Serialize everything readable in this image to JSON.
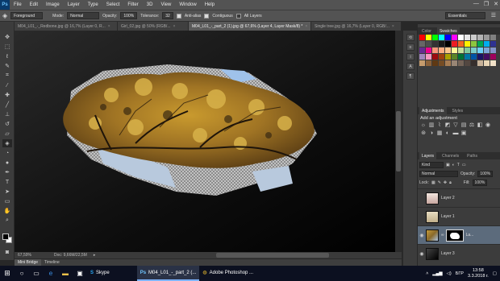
{
  "menubar": {
    "logo": "Ps",
    "items": [
      "File",
      "Edit",
      "Image",
      "Layer",
      "Type",
      "Select",
      "Filter",
      "3D",
      "View",
      "Window",
      "Help"
    ],
    "window_controls": [
      "—",
      "❐",
      "✕"
    ]
  },
  "options": {
    "source": "Foreground",
    "mode_label": "Mode:",
    "mode_value": "Normal",
    "opacity_label": "Opacity:",
    "opacity_value": "100%",
    "tolerance_label": "Tolerance:",
    "tolerance_value": "32",
    "antialias_label": "Anti-alias",
    "contiguous_label": "Contiguous",
    "all_layers_label": "All Layers",
    "workspace": "Essentials"
  },
  "tabs": [
    {
      "label": "M04_L01_-_Redbone.jpg @ 16,7% (Layer 0, R...",
      "active": false
    },
    {
      "label": "Girl_02.jpg @ 50% (RGB/...",
      "active": false
    },
    {
      "label": "M04_L01_-_part_2 (1).jpg @ 67,6% (Layer 4, Layer Mask/8) *",
      "active": true
    },
    {
      "label": "Single tree.jpg @ 16,7% (Layer 0, RGB/...",
      "active": false
    }
  ],
  "status": {
    "zoom": "67,59%",
    "doc": "Doc: 9,66M/22,5M"
  },
  "bridge": {
    "tabs": [
      "Mini Bridge",
      "Timeline"
    ]
  },
  "panels": {
    "color_tabs": [
      "Color",
      "Swatches"
    ],
    "adjust_tabs": [
      "Adjustments",
      "Styles"
    ],
    "adjust_title": "Add an adjustment",
    "layers_tabs": [
      "Layers",
      "Channels",
      "Paths"
    ],
    "kind_label": "Kind",
    "blend_mode": "Normal",
    "opacity_label": "Opacity:",
    "opacity_value": "100%",
    "lock_label": "Lock:",
    "fill_label": "Fill:",
    "fill_value": "100%",
    "layers": [
      {
        "name": "Layer 2",
        "visible": false,
        "active": false
      },
      {
        "name": "Layer 1",
        "visible": false,
        "active": false
      },
      {
        "name": "La...",
        "visible": true,
        "active": true
      },
      {
        "name": "Layer 3",
        "visible": true,
        "active": false
      }
    ]
  },
  "swatches": [
    "#ff0000",
    "#ffff00",
    "#00ff00",
    "#00ffff",
    "#0000ff",
    "#ff00ff",
    "#ffffff",
    "#e6e6e6",
    "#cccccc",
    "#b3b3b3",
    "#999999",
    "#808080",
    "#666666",
    "#4d4d4d",
    "#333333",
    "#1a1a1a",
    "#000000",
    "#ed1c24",
    "#f26522",
    "#fff200",
    "#8dc63f",
    "#00a651",
    "#00aeef",
    "#2e3192",
    "#662d91",
    "#ec008c",
    "#f7977a",
    "#fbad82",
    "#fdc68c",
    "#fff799",
    "#c4df9b",
    "#82ca9c",
    "#7accc8",
    "#6dcff6",
    "#7ea7d8",
    "#8493ca",
    "#a187be",
    "#f49ac1",
    "#9e0b0f",
    "#a0410d",
    "#aba000",
    "#598527",
    "#007236",
    "#0076a3",
    "#0054a6",
    "#1b1464",
    "#440e62",
    "#9e005d",
    "#c69c6d",
    "#8c6239",
    "#603913",
    "#754c24",
    "#a67c52",
    "#998675",
    "#736357",
    "#534741",
    "#362f2d",
    "#c7b299",
    "#e8d5b5",
    "#f1e1c8"
  ],
  "taskbar": {
    "apps": [
      {
        "label": "Skype",
        "active": false
      },
      {
        "label": "M04_L01_-_part_2 (...",
        "active": true
      },
      {
        "label": "Adobe Photoshop ...",
        "active": false
      }
    ],
    "lang": "БГР",
    "time": "13:58",
    "date": "3.3.2018 г."
  }
}
